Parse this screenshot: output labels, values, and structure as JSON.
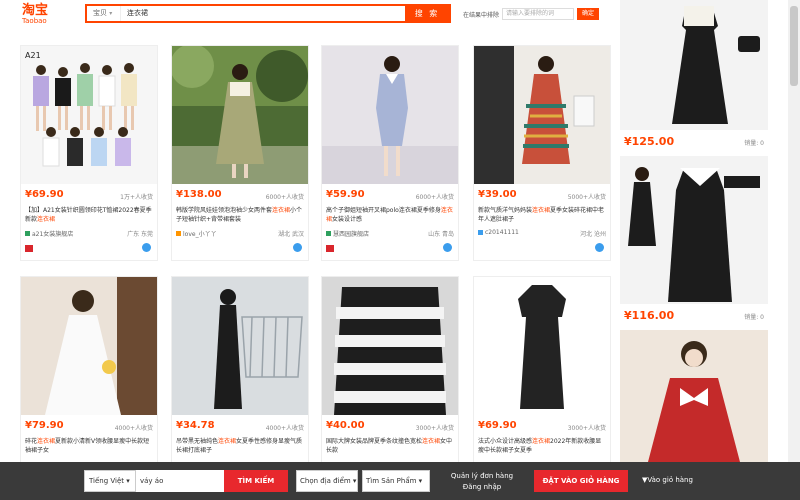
{
  "header": {
    "logo_cn": "淘宝",
    "logo_en": "Taobao",
    "search_scope": "宝贝",
    "search_query": "连衣裙",
    "search_button": "搜 索",
    "exclude_label": "在结果中排除",
    "exclude_placeholder": "请输入要排除的词",
    "exclude_ok": "确定"
  },
  "products": [
    {
      "price": "¥69.90",
      "sold": "1万+人收货",
      "title_pre": "【加】A21女装针织圆领印花T恤裙2022春夏季新款",
      "title_hl": "连衣裙",
      "title_post": "",
      "shop": "a21女装旗舰店",
      "loc": "广东 东莞"
    },
    {
      "price": "¥138.00",
      "sold": "6000+人收货",
      "title_pre": "韩版学院风娃娃领泡泡袖少女两件套",
      "title_hl": "连衣裙",
      "title_post": "小个子短袖针织+背带裙套装",
      "shop": "love_小丫丫",
      "loc": "湖北 武汉"
    },
    {
      "price": "¥59.90",
      "sold": "6000+人收货",
      "title_pre": "高个子御姐短袖开叉裙polo连衣裙夏季修身",
      "title_hl": "连衣裙",
      "title_post": "女装设计感",
      "shop": "慧西园旗舰店",
      "loc": "山东 青岛"
    },
    {
      "price": "¥39.00",
      "sold": "5000+人收货",
      "title_pre": "新款气质洋气妈妈装",
      "title_hl": "连衣裙",
      "title_post": "夏季女装碎花裙中老年人遮肚裙子",
      "shop": "c20141111",
      "loc": "河北 沧州"
    },
    {
      "price": "¥79.90",
      "sold": "4000+人收货",
      "title_pre": "碎花",
      "title_hl": "连衣裙",
      "title_post": "夏新款小清新V领收腰显瘦中长款短袖裙子女",
      "shop": "",
      "loc": ""
    },
    {
      "price": "¥34.78",
      "sold": "4000+人收货",
      "title_pre": "吊带黑无袖纯色",
      "title_hl": "连衣裙",
      "title_post": "女夏季性感修身显瘦气质长裙打底裙子",
      "shop": "",
      "loc": ""
    },
    {
      "price": "¥40.00",
      "sold": "3000+人收货",
      "title_pre": "国际大牌女装品牌夏季条纹撞色宽松",
      "title_hl": "连衣裙",
      "title_post": "女中长款",
      "shop": "",
      "loc": ""
    },
    {
      "price": "¥69.90",
      "sold": "3000+人收货",
      "title_pre": "法式小众设计高级感",
      "title_hl": "连衣裙",
      "title_post": "2022年新款收腰显瘦中长款裙子女夏季",
      "shop": "",
      "loc": ""
    }
  ],
  "right_column": [
    {
      "price": "¥125.00",
      "sold": "销量: 0"
    },
    {
      "price": "¥116.00",
      "sold": "销量: 0"
    }
  ],
  "bottombar": {
    "language": "Tiếng Việt",
    "search_value": "váy áo",
    "search_button": "TÌM KIẾM",
    "location_select": "Chọn địa điểm",
    "product_select": "Tìm Sản Phẩm",
    "link_orders": "Quản lý đơn hàng",
    "link_login": "Đăng nhập",
    "add_cart_button": "ĐẶT VÀO GIỎ HÀNG",
    "goto_cart": "Vào giỏ hàng"
  },
  "colors": {
    "accent": "#ff4400",
    "cta": "#e8282d",
    "bar": "#3a3a3a"
  }
}
